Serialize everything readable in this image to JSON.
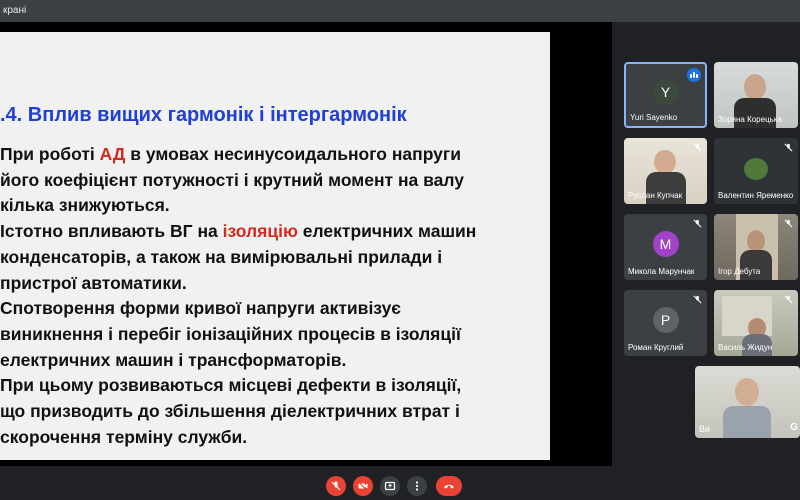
{
  "top_bar": {
    "title": "крані"
  },
  "slide": {
    "title": ".4. Вплив вищих гармонік і інтергармонік",
    "paragraphs": [
      {
        "pre": "При роботі ",
        "hl": "АД",
        "post": " в умовах несинусоидального напруги"
      },
      {
        "pre": "його коефіцієнт потужності і крутний момент на валу",
        "hl": "",
        "post": ""
      },
      {
        "pre": "кілька знижуються.",
        "hl": "",
        "post": ""
      },
      {
        "pre": " Істотно впливають ВГ на ",
        "hl": "ізоляцію",
        "post": " електричних машин"
      },
      {
        "pre": " конденсаторів, а також на вимірювальні прилади і",
        "hl": "",
        "post": ""
      },
      {
        "pre": "пристрої автоматики.",
        "hl": "",
        "post": ""
      },
      {
        "pre": "Спотворення форми кривої напруги активізує",
        "hl": "",
        "post": ""
      },
      {
        "pre": "виникнення і перебіг іонізаційних процесів в ізоляції",
        "hl": "",
        "post": ""
      },
      {
        "pre": "електричних машин і трансформаторів.",
        "hl": "",
        "post": ""
      },
      {
        "pre": "При цьому розвиваються місцеві дефекти в ізоляції,",
        "hl": "",
        "post": ""
      },
      {
        "pre": "що призводить до збільшення діелектричних втрат і",
        "hl": "",
        "post": ""
      },
      {
        "pre": "скорочення терміну служби.",
        "hl": "",
        "post": ""
      }
    ]
  },
  "participants": [
    {
      "name": "Yuri Sayenko",
      "initial": "Y",
      "avatar_color": "#3c4a3e",
      "speaking": true
    },
    {
      "name": "Зоряна Корецька",
      "initial": "",
      "avatar_color": "",
      "speaking": false
    },
    {
      "name": "Руслан Купчак",
      "initial": "",
      "avatar_color": "",
      "speaking": false
    },
    {
      "name": "Валентин Яременко",
      "initial": "",
      "avatar_color": "",
      "speaking": false
    },
    {
      "name": "Микола Марунчак",
      "initial": "M",
      "avatar_color": "#a142c9",
      "speaking": false
    },
    {
      "name": "Ігор Дебута",
      "initial": "",
      "avatar_color": "",
      "speaking": false
    },
    {
      "name": "Роман Круглий",
      "initial": "P",
      "avatar_color": "#5f6368",
      "speaking": false
    },
    {
      "name": "Василь Жидун",
      "initial": "",
      "avatar_color": "",
      "speaking": false
    },
    {
      "name": "Ви",
      "initial": "",
      "avatar_color": "",
      "speaking": false
    }
  ],
  "self_tile_corner_label": "G",
  "controls": {
    "icons": [
      "mic-off-icon",
      "camera-off-icon",
      "present-icon",
      "more-icon",
      "end-call-icon"
    ],
    "accent_colors": {
      "end_call": "#ea4335",
      "active_border": "#8ab4f8",
      "speaking": "#1a73e8"
    }
  }
}
